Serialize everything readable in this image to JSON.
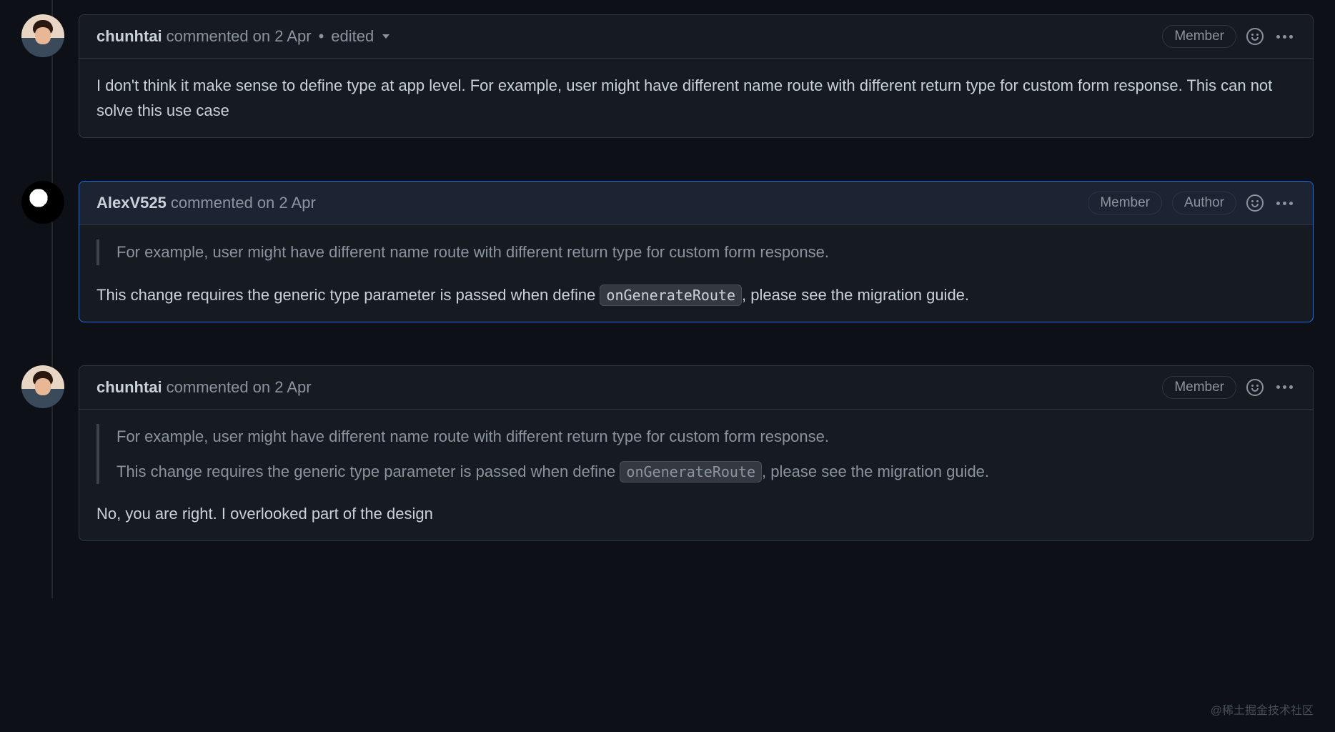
{
  "comments": [
    {
      "username": "chunhtai",
      "commented": "commented",
      "date": "on 2 Apr",
      "edited_dot": "•",
      "edited": "edited",
      "badges": [
        "Member"
      ],
      "body": "I don't think it make sense to define type at app level. For example, user might have different name route with different return type for custom form response. This can not solve this use case"
    },
    {
      "username": "AlexV525",
      "commented": "commented",
      "date": "on 2 Apr",
      "badges": [
        "Member",
        "Author"
      ],
      "quote": "For example, user might have different name route with different return type for custom form response.",
      "body_before_code": "This change requires the generic type parameter is passed when define ",
      "code": "onGenerateRoute",
      "body_after_code": ", please see the migration guide."
    },
    {
      "username": "chunhtai",
      "commented": "commented",
      "date": "on 2 Apr",
      "badges": [
        "Member"
      ],
      "quote": "For example, user might have different name route with different return type for custom form response.",
      "quote_body_before_code": "This change requires the generic type parameter is passed when define ",
      "quote_code": "onGenerateRoute",
      "quote_body_after_code": ", please see the migration guide.",
      "body": "No, you are right. I overlooked part of the design"
    }
  ],
  "watermark": "@稀土掘金技术社区"
}
